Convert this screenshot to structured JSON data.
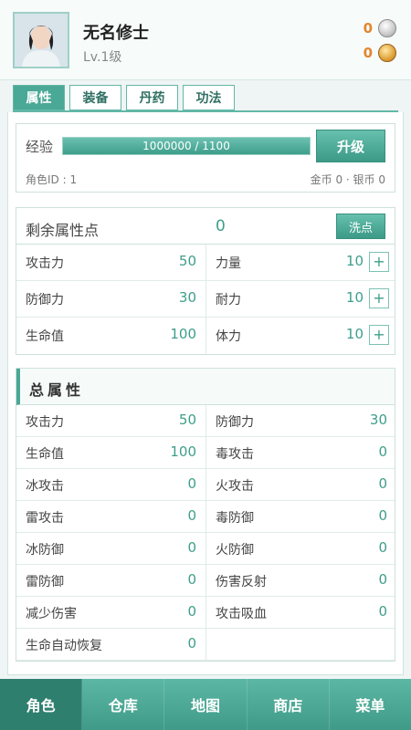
{
  "header": {
    "name": "无名修士",
    "level": "Lv.1级",
    "silver": "0",
    "gold": "0"
  },
  "tabs": [
    {
      "label": "属性"
    },
    {
      "label": "装备"
    },
    {
      "label": "丹药"
    },
    {
      "label": "功法"
    }
  ],
  "exp": {
    "label": "经验",
    "text": "1000000 / 1100",
    "fill_fraction": 1.0,
    "upgrade_label": "升级",
    "role_id": "角色ID : 1",
    "wealth": "金币 0 · 银币 0"
  },
  "alloc": {
    "title": "剩余属性点",
    "value": "0",
    "wash_label": "洗点",
    "rows": [
      {
        "left_label": "攻击力",
        "left_value": "50",
        "right_label": "力量",
        "right_value": "10"
      },
      {
        "left_label": "防御力",
        "left_value": "30",
        "right_label": "耐力",
        "right_value": "10"
      },
      {
        "left_label": "生命值",
        "left_value": "100",
        "right_label": "体力",
        "right_value": "10"
      }
    ],
    "plus_label": "+"
  },
  "total": {
    "title": "总属性",
    "rows": [
      {
        "left_label": "攻击力",
        "left_value": "50",
        "right_label": "防御力",
        "right_value": "30"
      },
      {
        "left_label": "生命值",
        "left_value": "100",
        "right_label": "毒攻击",
        "right_value": "0"
      },
      {
        "left_label": "冰攻击",
        "left_value": "0",
        "right_label": "火攻击",
        "right_value": "0"
      },
      {
        "left_label": "雷攻击",
        "left_value": "0",
        "right_label": "毒防御",
        "right_value": "0"
      },
      {
        "left_label": "冰防御",
        "left_value": "0",
        "right_label": "火防御",
        "right_value": "0"
      },
      {
        "left_label": "雷防御",
        "left_value": "0",
        "right_label": "伤害反射",
        "right_value": "0"
      },
      {
        "left_label": "减少伤害",
        "left_value": "0",
        "right_label": "攻击吸血",
        "right_value": "0"
      },
      {
        "left_label": "生命自动恢复",
        "left_value": "0",
        "right_label": "",
        "right_value": ""
      }
    ]
  },
  "nav": [
    {
      "label": "角色"
    },
    {
      "label": "仓库"
    },
    {
      "label": "地图"
    },
    {
      "label": "商店"
    },
    {
      "label": "菜单"
    }
  ],
  "colors": {
    "accent": "#4aa896",
    "accent_dark": "#2f7f6f",
    "currency": "#e3862f"
  },
  "icons": [
    "avatar-portrait",
    "silver-coin-icon",
    "gold-coin-icon",
    "plus-icon"
  ]
}
